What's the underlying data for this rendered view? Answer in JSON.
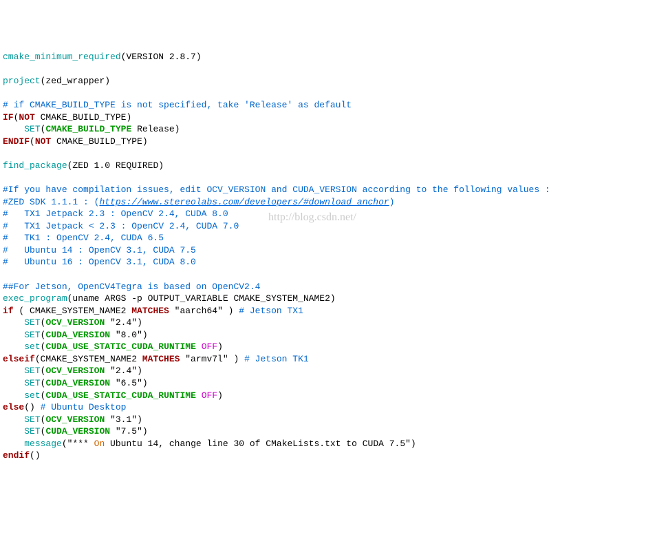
{
  "l1_a": "cmake_minimum_required",
  "l1_b": "(VERSION 2.8.7)",
  "l3_a": "project",
  "l3_b": "(zed_wrapper)",
  "l5": "# if CMAKE_BUILD_TYPE is not specified, take 'Release' as default",
  "l6_a": "IF",
  "l6_b": "(",
  "l6_c": "NOT",
  "l6_d": " CMAKE_BUILD_TYPE)",
  "l7_a": "    ",
  "l7_b": "SET",
  "l7_c": "(",
  "l7_d": "CMAKE_BUILD_TYPE",
  "l7_e": " Release)",
  "l8_a": "ENDIF",
  "l8_b": "(",
  "l8_c": "NOT",
  "l8_d": " CMAKE_BUILD_TYPE)",
  "l10_a": "find_package",
  "l10_b": "(ZED 1.0 REQUIRED)",
  "l12": "#If you have compilation issues, edit OCV_VERSION and CUDA_VERSION according to the following values :",
  "l13_a": "#ZED SDK 1.1.1 : (",
  "l13_b": "https://www.stereolabs.com/developers/#download_anchor",
  "l13_c": ")",
  "l14": "#   TX1 Jetpack 2.3 : OpenCV 2.4, CUDA 8.0",
  "l15": "#   TX1 Jetpack < 2.3 : OpenCV 2.4, CUDA 7.0",
  "l16": "#   TK1 : OpenCV 2.4, CUDA 6.5",
  "l17": "#   Ubuntu 14 : OpenCV 3.1, CUDA 7.5",
  "l18": "#   Ubuntu 16 : OpenCV 3.1, CUDA 8.0",
  "l20": "##For Jetson, OpenCV4Tegra is based on OpenCV2.4",
  "l21_a": "exec_program",
  "l21_b": "(uname ARGS -p OUTPUT_VARIABLE CMAKE_SYSTEM_NAME2)",
  "l22_a": "if",
  "l22_b": " ( CMAKE_SYSTEM_NAME2 ",
  "l22_c": "MATCHES",
  "l22_d": " \"aarch64\" ) ",
  "l22_e": "# Jetson TX1",
  "l23_a": "    ",
  "l23_b": "SET",
  "l23_c": "(",
  "l23_d": "OCV_VERSION",
  "l23_e": " \"2.4\")",
  "l24_a": "    ",
  "l24_b": "SET",
  "l24_c": "(",
  "l24_d": "CUDA_VERSION",
  "l24_e": " \"8.0\")",
  "l25_a": "    ",
  "l25_b": "set",
  "l25_c": "(",
  "l25_d": "CUDA_USE_STATIC_CUDA_RUNTIME",
  "l25_e": " ",
  "l25_f": "OFF",
  "l25_g": ")",
  "l26_a": "elseif",
  "l26_b": "(CMAKE_SYSTEM_NAME2 ",
  "l26_c": "MATCHES",
  "l26_d": " \"armv7l\" ) ",
  "l26_e": "# Jetson TK1",
  "l27_a": "    ",
  "l27_b": "SET",
  "l27_c": "(",
  "l27_d": "OCV_VERSION",
  "l27_e": " \"2.4\")",
  "l28_a": "    ",
  "l28_b": "SET",
  "l28_c": "(",
  "l28_d": "CUDA_VERSION",
  "l28_e": " \"6.5\")",
  "l29_a": "    ",
  "l29_b": "set",
  "l29_c": "(",
  "l29_d": "CUDA_USE_STATIC_CUDA_RUNTIME",
  "l29_e": " ",
  "l29_f": "OFF",
  "l29_g": ")",
  "l30_a": "else",
  "l30_b": "() ",
  "l30_c": "# Ubuntu Desktop",
  "l31_a": "    ",
  "l31_b": "SET",
  "l31_c": "(",
  "l31_d": "OCV_VERSION",
  "l31_e": " \"3.1\")",
  "l32_a": "    ",
  "l32_b": "SET",
  "l32_c": "(",
  "l32_d": "CUDA_VERSION",
  "l32_e": " \"7.5\")",
  "l33_a": "    ",
  "l33_b": "message",
  "l33_c": "(\"*** ",
  "l33_d": "On",
  "l33_e": " Ubuntu 14, change line 30 of CMakeLists.txt to CUDA 7.5\")",
  "l34_a": "endif",
  "l34_b": "()",
  "watermark": "http://blog.csdn.net/"
}
